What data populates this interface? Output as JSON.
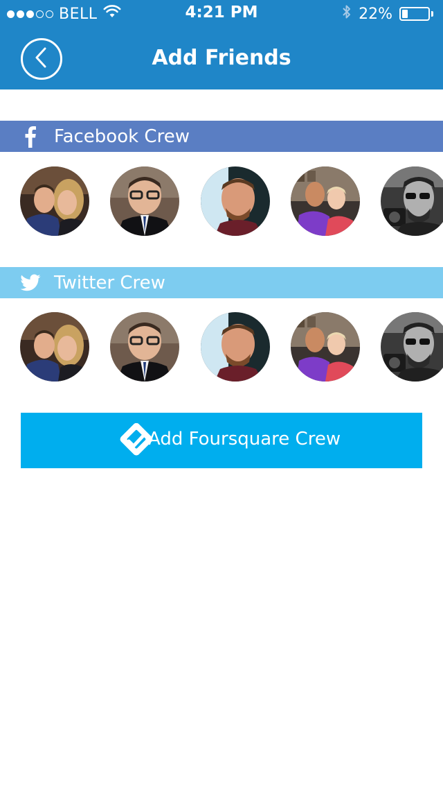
{
  "status_bar": {
    "carrier": "BELL",
    "time": "4:21 PM",
    "battery": "22%",
    "battery_level": 0.22,
    "signal_bars_filled": 3,
    "signal_bars_total": 5,
    "icons": [
      "wifi-icon",
      "bluetooth-icon",
      "battery-icon"
    ]
  },
  "nav": {
    "title": "Add Friends",
    "back_icon": "chevron-left-icon"
  },
  "sections": {
    "facebook": {
      "label": "Facebook Crew",
      "icon": "facebook-icon",
      "color": "#5a7ec3"
    },
    "twitter": {
      "label": "Twitter Crew",
      "icon": "twitter-icon",
      "color": "#7dccf0"
    }
  },
  "friends_avatars": [
    "avatar-couple",
    "avatar-glasses-man",
    "avatar-bearded-man",
    "avatar-couple-purple",
    "avatar-sunglasses-man"
  ],
  "foursquare_button": {
    "label": "Add Foursquare Crew",
    "icon": "foursquare-icon",
    "color": "#00aeee"
  },
  "colors": {
    "header": "#1f86c8",
    "background": "#ffffff"
  }
}
